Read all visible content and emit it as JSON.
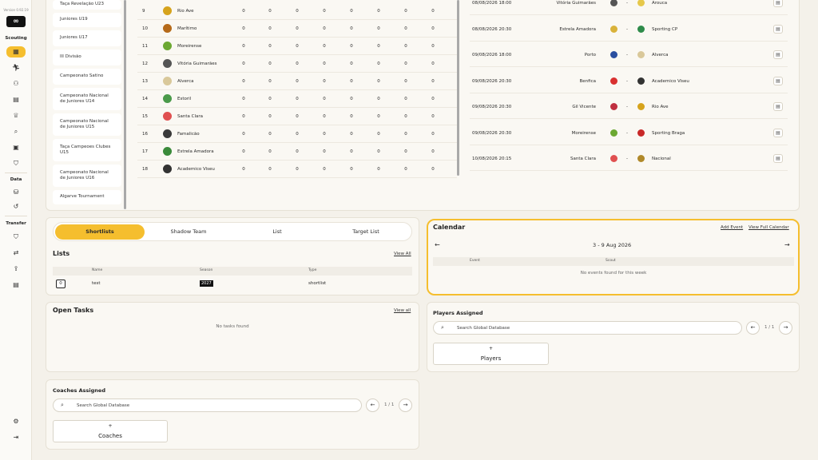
{
  "sidebar": {
    "version": "Version 0.92.19",
    "logo": "∞",
    "sections": {
      "scouting": "Scouting",
      "data": "Data",
      "transfer": "Transfer"
    }
  },
  "competitions": [
    "Taça Revelação U23",
    "Juniores U19",
    "Juniores U17",
    "III Divisão",
    "Campeonato Satino",
    "Campeonato Nacional de Juniores U14",
    "Campeonato Nacional de Juniores U15",
    "Taça Campeoes Clubes U15",
    "Campeonato Nacional de Juniores U16",
    "Algarve Tournament"
  ],
  "standings": [
    {
      "pos": "9",
      "team": "Rio Ave",
      "crest": "#d6a31c",
      "vals": [
        "0",
        "0",
        "0",
        "0",
        "0",
        "0",
        "0",
        "0"
      ]
    },
    {
      "pos": "10",
      "team": "Marítimo",
      "crest": "#b56a1a",
      "vals": [
        "0",
        "0",
        "0",
        "0",
        "0",
        "0",
        "0",
        "0"
      ]
    },
    {
      "pos": "11",
      "team": "Moreirense",
      "crest": "#6ca832",
      "vals": [
        "0",
        "0",
        "0",
        "0",
        "0",
        "0",
        "0",
        "0"
      ]
    },
    {
      "pos": "12",
      "team": "Vitória Guimarães",
      "crest": "#555555",
      "vals": [
        "0",
        "0",
        "0",
        "0",
        "0",
        "0",
        "0",
        "0"
      ]
    },
    {
      "pos": "13",
      "team": "Alverca",
      "crest": "#d9c89a",
      "vals": [
        "0",
        "0",
        "0",
        "0",
        "0",
        "0",
        "0",
        "0"
      ]
    },
    {
      "pos": "14",
      "team": "Estoril",
      "crest": "#4a9a4a",
      "vals": [
        "0",
        "0",
        "0",
        "0",
        "0",
        "0",
        "0",
        "0"
      ]
    },
    {
      "pos": "15",
      "team": "Santa Clara",
      "crest": "#e05050",
      "vals": [
        "0",
        "0",
        "0",
        "0",
        "0",
        "0",
        "0",
        "0"
      ]
    },
    {
      "pos": "16",
      "team": "Famalicão",
      "crest": "#3a3a3a",
      "vals": [
        "0",
        "0",
        "0",
        "0",
        "0",
        "0",
        "0",
        "0"
      ]
    },
    {
      "pos": "17",
      "team": "Estrela Amadora",
      "crest": "#3a8a3a",
      "vals": [
        "0",
        "0",
        "0",
        "0",
        "0",
        "0",
        "0",
        "0"
      ]
    },
    {
      "pos": "18",
      "team": "Academico Viseu",
      "crest": "#333333",
      "vals": [
        "0",
        "0",
        "0",
        "0",
        "0",
        "0",
        "0",
        "0"
      ]
    }
  ],
  "fixtures": [
    {
      "date": "08/08/2026 18:00",
      "home": "Vitória Guimarães",
      "hc": "#555555",
      "away": "Arouca",
      "ac": "#e6c84a"
    },
    {
      "date": "08/08/2026 20:30",
      "home": "Estrela Amadora",
      "hc": "#d9b23a",
      "away": "Sporting CP",
      "ac": "#2e8b4a"
    },
    {
      "date": "09/08/2026 18:00",
      "home": "Porto",
      "hc": "#2a4fa0",
      "away": "Alverca",
      "ac": "#d9c89a"
    },
    {
      "date": "09/08/2026 20:30",
      "home": "Benfica",
      "hc": "#d93030",
      "away": "Academico Viseu",
      "ac": "#333333"
    },
    {
      "date": "09/08/2026 20:30",
      "home": "Gil Vicente",
      "hc": "#c03040",
      "away": "Rio Ave",
      "ac": "#d6a31c"
    },
    {
      "date": "09/08/2026 20:30",
      "home": "Moreirense",
      "hc": "#6ca832",
      "away": "Sporting Braga",
      "ac": "#c82828"
    },
    {
      "date": "10/08/2026 20:15",
      "home": "Santa Clara",
      "hc": "#e05050",
      "away": "Nacional",
      "ac": "#b0892a"
    }
  ],
  "tabs": [
    "Shortlists",
    "Shadow Team",
    "List",
    "Target List"
  ],
  "lists": {
    "title": "Lists",
    "view_all": "View All",
    "columns": [
      "Name",
      "Season",
      "Type"
    ],
    "rows": [
      {
        "count": "0",
        "name": "test",
        "season": "2027",
        "type": "shortlist"
      }
    ]
  },
  "calendar": {
    "title": "Calendar",
    "add_event": "Add Event",
    "view_full": "View Full Calendar",
    "range": "3 - 9 Aug 2026",
    "columns": [
      "Event",
      "Scout"
    ],
    "empty": "No events found for this week"
  },
  "tasks": {
    "title": "Open Tasks",
    "view_all": "View all",
    "empty": "No tasks found"
  },
  "players_assigned": {
    "title": "Players Assigned",
    "search_placeholder": "Search Global Database",
    "pager": "1 / 1",
    "add_plus": "+",
    "add_label": "Players"
  },
  "coaches_assigned": {
    "title": "Coaches Assigned",
    "search_placeholder": "Search Global Database",
    "pager": "1 / 1",
    "add_plus": "+",
    "add_label": "Coaches"
  }
}
